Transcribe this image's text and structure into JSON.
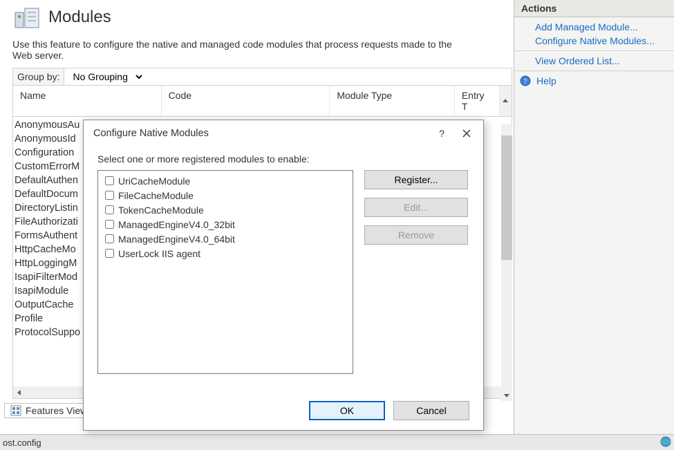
{
  "page": {
    "title": "Modules",
    "description": "Use this feature to configure the native and managed code modules that process requests made to the Web server."
  },
  "groupby": {
    "label": "Group by:",
    "selected": "No Grouping"
  },
  "grid": {
    "columns": {
      "name": "Name",
      "code": "Code",
      "module_type": "Module Type",
      "entry": "Entry T"
    },
    "rows": [
      {
        "name": "AnonymousAu"
      },
      {
        "name": "AnonymousId"
      },
      {
        "name": "Configuration"
      },
      {
        "name": "CustomErrorM"
      },
      {
        "name": "DefaultAuthen"
      },
      {
        "name": "DefaultDocum"
      },
      {
        "name": "DirectoryListin"
      },
      {
        "name": "FileAuthorizati"
      },
      {
        "name": "FormsAuthent"
      },
      {
        "name": "HttpCacheMo"
      },
      {
        "name": "HttpLoggingM"
      },
      {
        "name": "IsapiFilterMod"
      },
      {
        "name": "IsapiModule"
      },
      {
        "name": "OutputCache"
      },
      {
        "name": "Profile"
      },
      {
        "name": "ProtocolSuppo"
      }
    ]
  },
  "features_view": "Features View",
  "statusbar": {
    "text": "ost.config"
  },
  "actions": {
    "title": "Actions",
    "links": {
      "add_managed": "Add Managed Module...",
      "configure_native": "Configure Native Modules...",
      "view_ordered": "View Ordered List...",
      "help": "Help"
    }
  },
  "dialog": {
    "title": "Configure Native Modules",
    "instruction": "Select one or more registered modules to enable:",
    "modules": [
      "UriCacheModule",
      "FileCacheModule",
      "TokenCacheModule",
      "ManagedEngineV4.0_32bit",
      "ManagedEngineV4.0_64bit",
      "UserLock IIS agent"
    ],
    "buttons": {
      "register": "Register...",
      "edit": "Edit...",
      "remove": "Remove",
      "ok": "OK",
      "cancel": "Cancel"
    }
  }
}
